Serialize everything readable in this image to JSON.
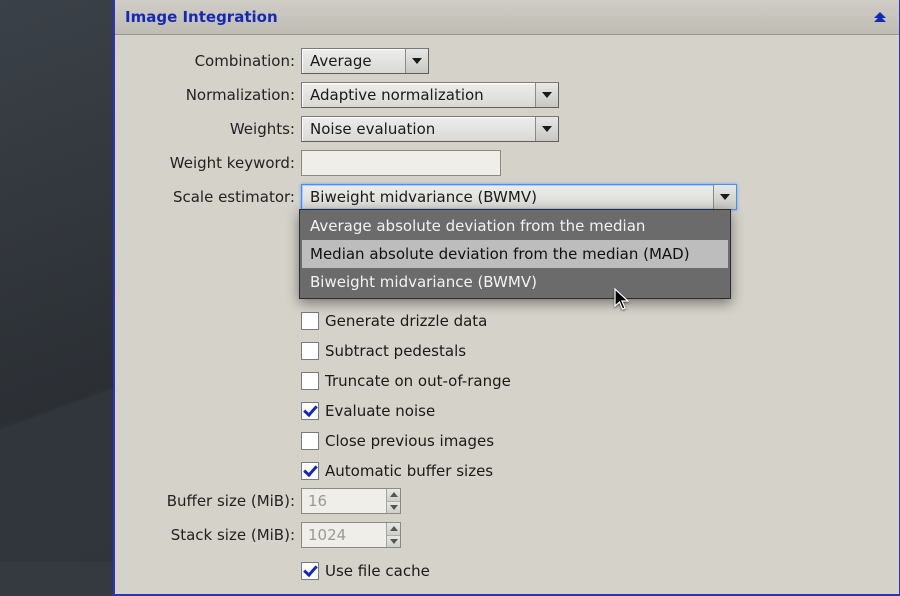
{
  "section": {
    "title": "Image Integration"
  },
  "rows": {
    "combination": {
      "label": "Combination:",
      "value": "Average"
    },
    "normalization": {
      "label": "Normalization:",
      "value": "Adaptive normalization"
    },
    "weights": {
      "label": "Weights:",
      "value": "Noise evaluation"
    },
    "weight_keyword": {
      "label": "Weight keyword:",
      "value": ""
    },
    "scale_estimator": {
      "label": "Scale estimator:",
      "value": "Biweight midvariance (BWMV)",
      "options": [
        "Average absolute deviation from the median",
        "Median absolute deviation from the median (MAD)",
        "Biweight midvariance (BWMV)"
      ],
      "hover_index": 1
    },
    "buffer_size": {
      "label": "Buffer size (MiB):",
      "value": "16"
    },
    "stack_size": {
      "label": "Stack size (MiB):",
      "value": "1024"
    }
  },
  "checks": {
    "generate_drizzle": {
      "label": "Generate drizzle data",
      "checked": false
    },
    "subtract_pedestals": {
      "label": "Subtract pedestals",
      "checked": false
    },
    "truncate_oor": {
      "label": "Truncate on out-of-range",
      "checked": false
    },
    "evaluate_noise": {
      "label": "Evaluate noise",
      "checked": true
    },
    "close_prev": {
      "label": "Close previous images",
      "checked": false
    },
    "auto_buf": {
      "label": "Automatic buffer sizes",
      "checked": true
    },
    "use_file_cache": {
      "label": "Use file cache",
      "checked": true
    }
  }
}
